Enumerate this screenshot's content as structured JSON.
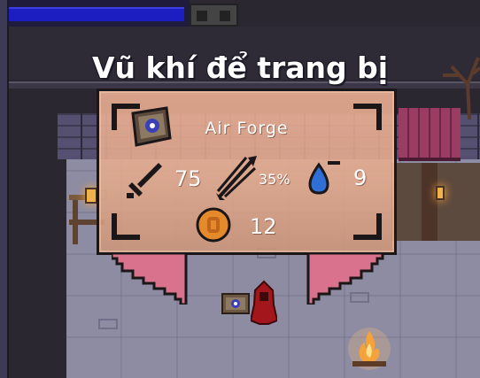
{
  "hud": {
    "health_fraction": 0.97
  },
  "popup": {
    "title": "Vũ khí để trang bị",
    "weapon_name": "Air Forge",
    "stats": {
      "damage": "75",
      "crit_chance": "35%",
      "mana_cost": "9",
      "price": "12"
    },
    "icons": {
      "weapon": "spellbook-icon",
      "damage": "sword-icon",
      "crit": "multi-arrow-icon",
      "mana": "water-drop-icon",
      "price": "gold-coin-icon"
    }
  },
  "colors": {
    "panel_fill": "#f0b296",
    "panel_border": "#1b1617",
    "pointer_fill": "#d9728c",
    "mana_blue": "#2f6fd6",
    "coin_orange": "#e58a2a",
    "health_blue": "#1d1ec2"
  }
}
